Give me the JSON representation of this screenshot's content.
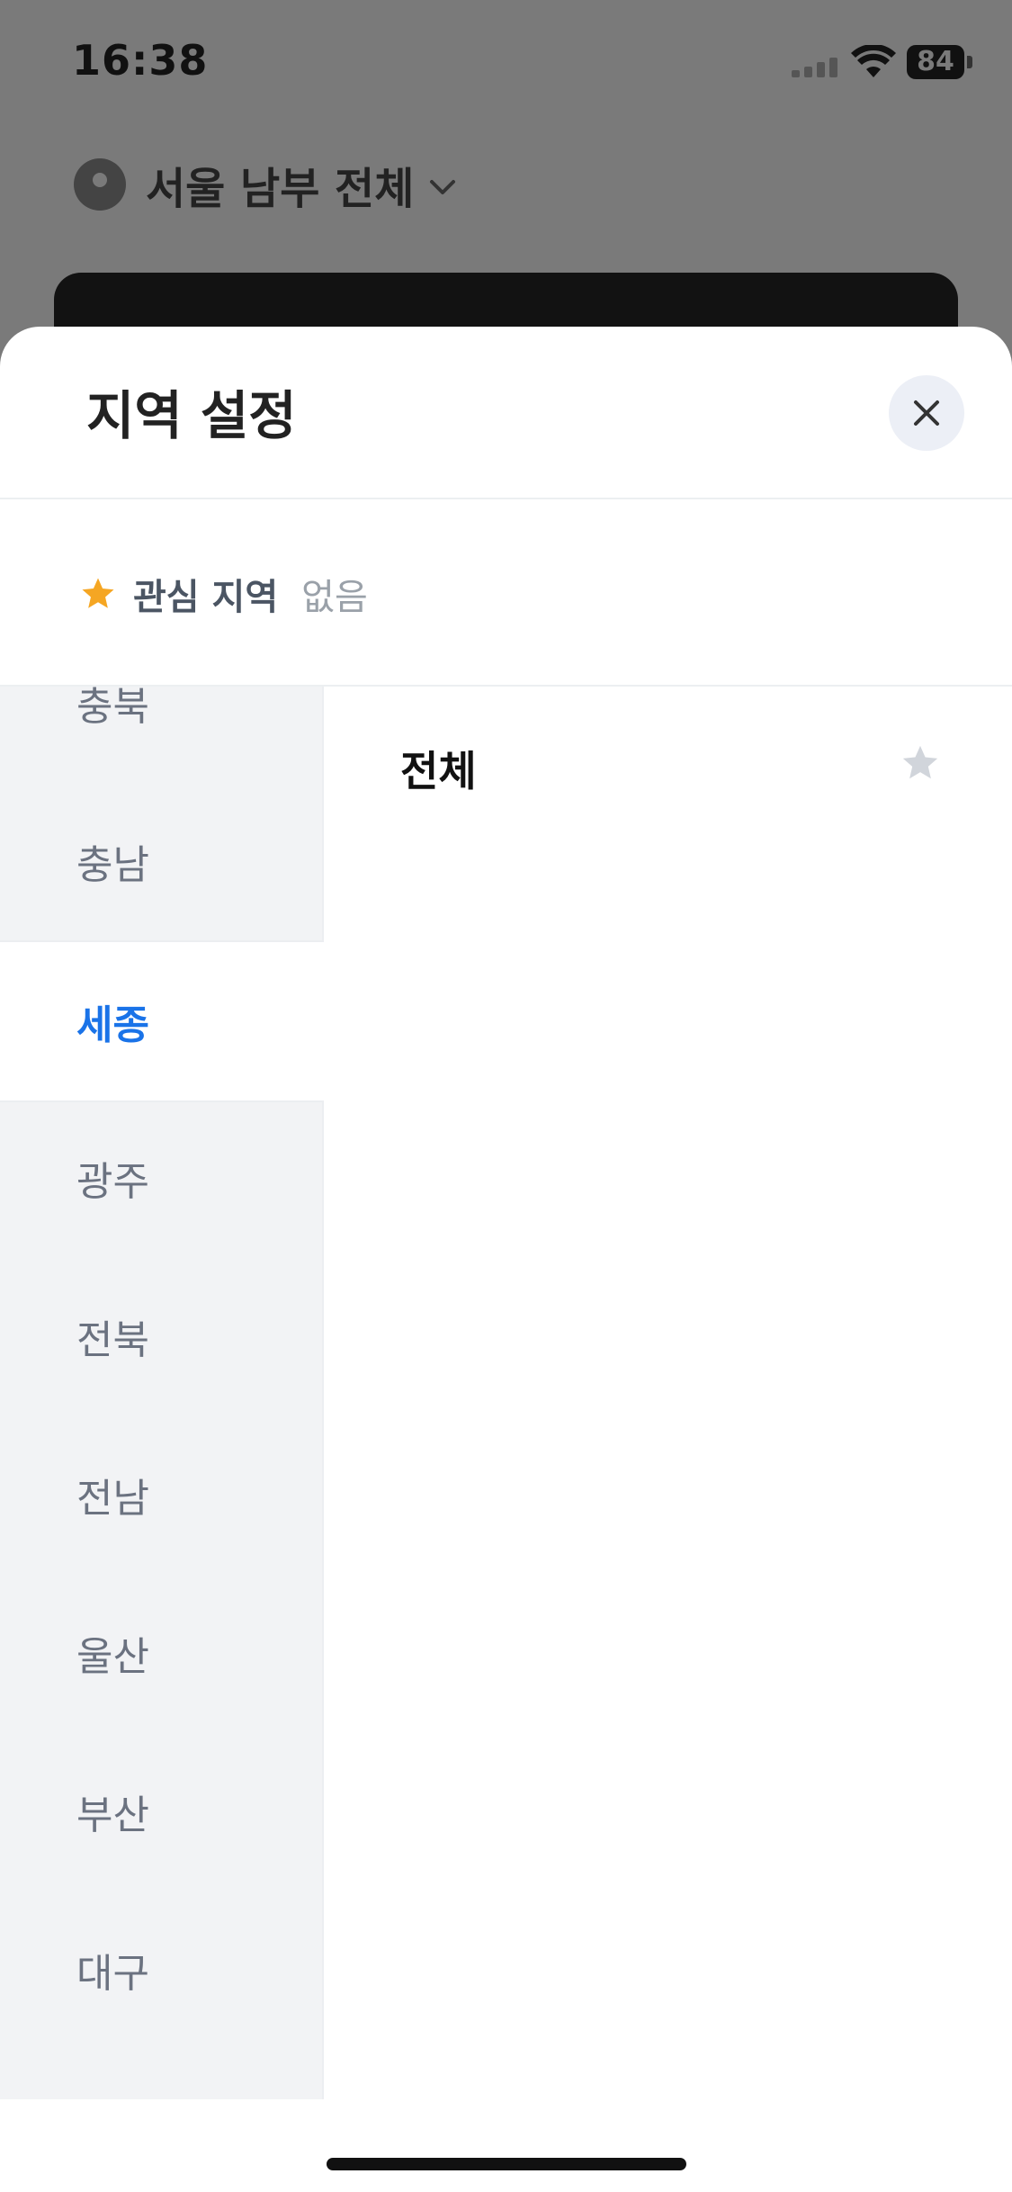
{
  "status_bar": {
    "time": "16:38",
    "battery": "84"
  },
  "header": {
    "location_label": "서울 남부 전체"
  },
  "sheet": {
    "title": "지역 설정",
    "favorites": {
      "label": "관심 지역",
      "value": "없음"
    },
    "regions": [
      "충북",
      "충남",
      "세종",
      "광주",
      "전북",
      "전남",
      "울산",
      "부산",
      "대구"
    ],
    "selected_region": "세종",
    "sub_regions": [
      {
        "label": "전체",
        "favorited": false
      }
    ]
  },
  "colors": {
    "accent": "#1a73e8",
    "star_active": "#f5a623",
    "star_inactive": "#d1d5db"
  }
}
